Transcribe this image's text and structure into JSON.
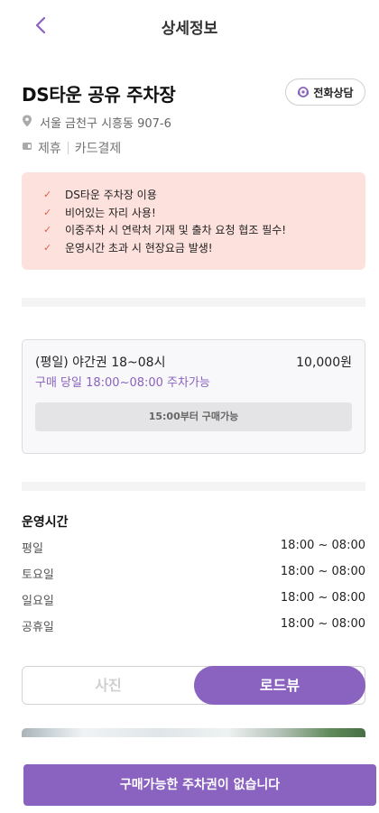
{
  "header": {
    "title": "상세정보",
    "back_icon": "back-arrow-icon"
  },
  "lot": {
    "name": "DS타운 공유 주차장",
    "call_label": "전화상담",
    "address": "서울 금천구 시흥동 907-6",
    "tags": [
      "제휴",
      "카드결제"
    ]
  },
  "notice": {
    "items": [
      "DS타운 주차장 이용",
      "비어있는 자리 사용!",
      "이중주차 시 연락처 기재 및 출차 요청 협조 필수!",
      "운영시간 초과 시 현장요금 발생!"
    ]
  },
  "ticket": {
    "name": "(평일) 야간권 18~08시",
    "price": "10,000원",
    "sub": "구매 당일 18:00~08:00 주차가능",
    "availability": "15:00부터 구매가능"
  },
  "hours": {
    "title": "운영시간",
    "rows": [
      {
        "day": "평일",
        "time": "18:00 ~ 08:00"
      },
      {
        "day": "토요일",
        "time": "18:00 ~ 08:00"
      },
      {
        "day": "일요일",
        "time": "18:00 ~ 08:00"
      },
      {
        "day": "공휴일",
        "time": "18:00 ~ 08:00"
      }
    ]
  },
  "view_toggle": {
    "photo_label": "사진",
    "roadview_label": "로드뷰",
    "selected": "로드뷰"
  },
  "cta": {
    "label": "구매가능한 주차권이 없습니다"
  },
  "colors": {
    "accent": "#8a62bf",
    "notice_bg": "#fde1dd",
    "check": "#e0604c"
  }
}
